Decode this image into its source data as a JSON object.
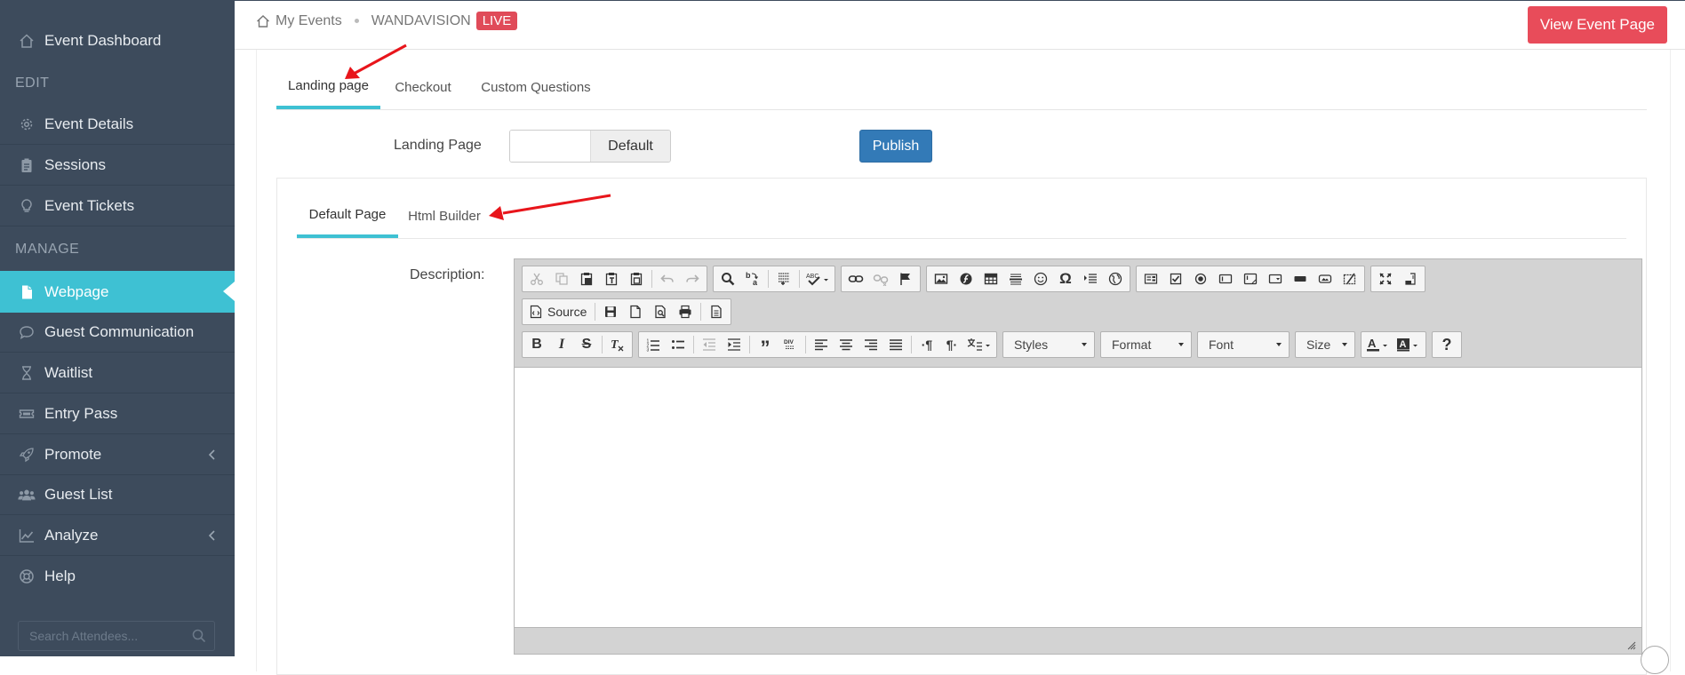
{
  "sidebar": {
    "items": [
      {
        "label": "Event Dashboard",
        "icon": "home-icon"
      },
      {
        "label": "Event Details",
        "icon": "gear-icon"
      },
      {
        "label": "Sessions",
        "icon": "clipboard-icon"
      },
      {
        "label": "Event Tickets",
        "icon": "lightbulb-icon"
      },
      {
        "label": "Webpage",
        "icon": "file-icon"
      },
      {
        "label": "Guest Communication",
        "icon": "speech-bubble-icon"
      },
      {
        "label": "Waitlist",
        "icon": "hourglass-icon"
      },
      {
        "label": "Entry Pass",
        "icon": "ticket-icon"
      },
      {
        "label": "Promote",
        "icon": "rocket-icon"
      },
      {
        "label": "Guest List",
        "icon": "users-icon"
      },
      {
        "label": "Analyze",
        "icon": "area-chart-icon"
      },
      {
        "label": "Help",
        "icon": "life-ring-icon"
      }
    ],
    "sections": {
      "edit": "EDIT",
      "manage": "MANAGE"
    },
    "search_placeholder": "Search Attendees...",
    "active_color": "#3ec1d3",
    "background": "#3d4b5c"
  },
  "header": {
    "breadcrumb_home": "My Events",
    "event_name": "WANDAVISION",
    "live_badge": "LIVE",
    "view_button": "View Event Page"
  },
  "page_tabs": [
    {
      "label": "Landing page",
      "active": true
    },
    {
      "label": "Checkout",
      "active": false
    },
    {
      "label": "Custom Questions",
      "active": false
    }
  ],
  "landing_page": {
    "label": "Landing Page",
    "toggle_value": "Default",
    "publish_button": "Publish"
  },
  "sub_tabs": [
    {
      "label": "Default Page",
      "active": true
    },
    {
      "label": "Html Builder",
      "active": false
    }
  ],
  "editor": {
    "label": "Description:",
    "source_label": "Source",
    "combos": [
      "Styles",
      "Format",
      "Font",
      "Size"
    ],
    "help_label": "?"
  }
}
